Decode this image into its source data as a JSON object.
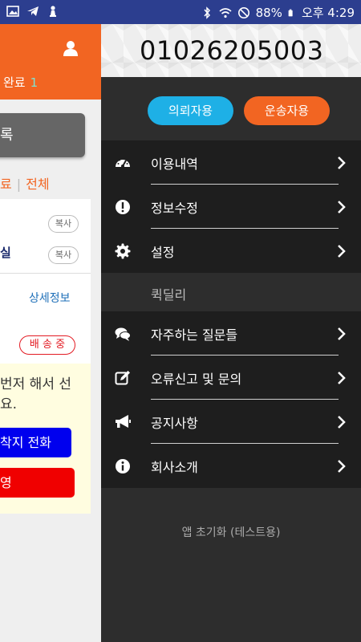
{
  "status_bar": {
    "battery": "88%",
    "time": "오후 4:29"
  },
  "left_app": {
    "completed_label": "완료",
    "completed_count": "1",
    "register_label": "록",
    "filter_done": "료",
    "filter_all": "전체",
    "copy_label": "복사",
    "place_fragment": "실",
    "detail_link": "상세정보",
    "status_badge": "배 송 중",
    "notice_line1": "번저 해서 선",
    "notice_line2": "요.",
    "call_button": "착지 전화",
    "red_button": "영"
  },
  "drawer": {
    "phone_number": "01026205003",
    "client_button": "의뢰자용",
    "driver_button": "운송자용",
    "menu_top": [
      {
        "label": "이용내역",
        "icon": "speedometer-icon"
      },
      {
        "label": "정보수정",
        "icon": "exclamation-icon"
      },
      {
        "label": "설정",
        "icon": "gear-icon"
      }
    ],
    "section_title": "퀵딜리",
    "menu_bottom": [
      {
        "label": "자주하는 질문들",
        "icon": "chat-bubbles-icon"
      },
      {
        "label": "오류신고 및 문의",
        "icon": "edit-icon"
      },
      {
        "label": "공지사항",
        "icon": "megaphone-icon"
      },
      {
        "label": "회사소개",
        "icon": "info-icon"
      }
    ],
    "reset_label": "앱 초기화 (테스트용)"
  },
  "colors": {
    "orange": "#f26522",
    "blue": "#1eb0e6",
    "statusbar": "#2c3e8f"
  }
}
